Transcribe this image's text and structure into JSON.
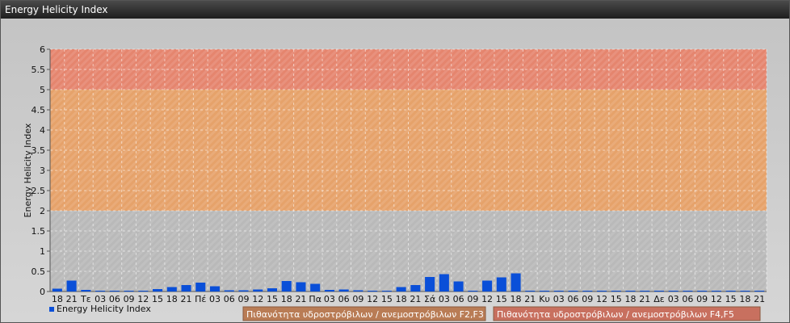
{
  "window": {
    "title": "Energy Helicity Index"
  },
  "chart_data": {
    "type": "bar",
    "ylabel": "Energy Helicity Index",
    "ylim": [
      0,
      6
    ],
    "yticks": [
      "0",
      "0.5",
      "1",
      "1.5",
      "2",
      "2.5",
      "3",
      "3.5",
      "4",
      "4.5",
      "5",
      "5.5",
      "6"
    ],
    "categories": [
      "18",
      "21",
      "Τε",
      "03",
      "06",
      "09",
      "12",
      "15",
      "18",
      "21",
      "Πέ",
      "03",
      "06",
      "09",
      "12",
      "15",
      "18",
      "21",
      "Πα",
      "03",
      "06",
      "09",
      "12",
      "15",
      "18",
      "21",
      "Σά",
      "03",
      "06",
      "09",
      "12",
      "15",
      "18",
      "21",
      "Κυ",
      "03",
      "06",
      "09",
      "12",
      "15",
      "18",
      "21",
      "Δε",
      "03",
      "06",
      "09",
      "12",
      "15",
      "18",
      "21"
    ],
    "series": [
      {
        "name": "Energy Helicity Index",
        "color": "#0a4fd8",
        "values": [
          0.07,
          0.27,
          0.04,
          0.02,
          0.02,
          0.02,
          0.02,
          0.06,
          0.11,
          0.16,
          0.22,
          0.13,
          0.03,
          0.03,
          0.05,
          0.08,
          0.26,
          0.23,
          0.19,
          0.04,
          0.05,
          0.03,
          0.02,
          0.02,
          0.11,
          0.16,
          0.36,
          0.43,
          0.25,
          0.02,
          0.27,
          0.35,
          0.45,
          0.02,
          0.02,
          0.02,
          0.02,
          0.02,
          0.02,
          0.02,
          0.02,
          0.02,
          0.02,
          0.02,
          0.02,
          0.02,
          0.02,
          0.02,
          0.02,
          0.02
        ]
      }
    ],
    "bands": [
      {
        "from": 5,
        "to": 6,
        "color": "#e5856e"
      },
      {
        "from": 2,
        "to": 5,
        "color": "#e6a26a"
      },
      {
        "from": 0,
        "to": 2,
        "color": "#b9b9b9"
      }
    ],
    "grid": true,
    "legend": {
      "series_label": "Energy Helicity Index",
      "band_labels": [
        {
          "text": "Πιθανότητα υδροστρόβιλων / ανεμοστρόβιλων F2,F3",
          "color": "#b97c55"
        },
        {
          "text": "Πιθανότητα υδροστρόβιλων / ανεμοστρόβιλων F4,F5",
          "color": "#c8705f"
        }
      ]
    }
  }
}
